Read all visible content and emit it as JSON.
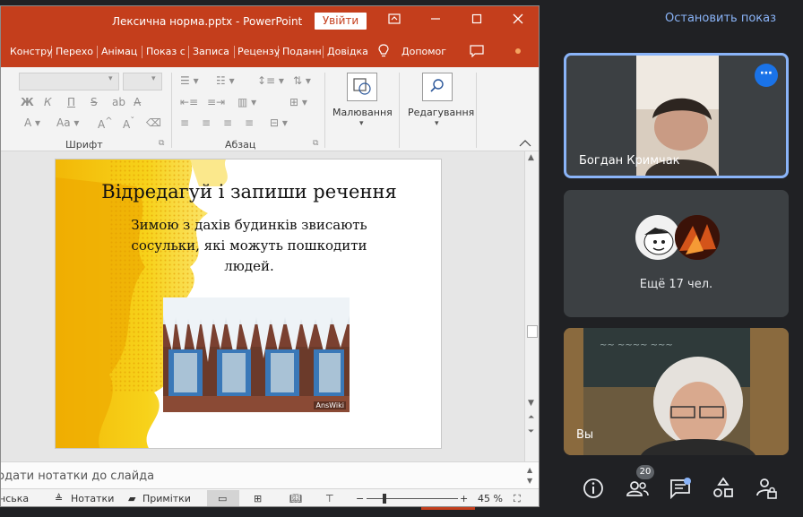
{
  "ppt": {
    "window_title": "Лексична норма.pptx  -  PowerPoint",
    "signin_label": "Увійти",
    "tabs": [
      "Констру",
      "Перехо",
      "Анімац",
      "Показ с",
      "Записа",
      "Рецензу",
      "Поданн",
      "Довідка"
    ],
    "tell_me": "Допомог",
    "ribbon": {
      "font_group_label": "Шрифт",
      "paragraph_group_label": "Абзац",
      "bold": "Ж",
      "italic": "К",
      "underline": "П",
      "strike": "S",
      "drawing_label": "Малювання",
      "editing_label": "Редагування"
    },
    "slide": {
      "title": "Відредагуй і запиши речення",
      "body": "Зимою з дахів будинків звисають сосульки, які можуть пошкодити людей.",
      "watermark": "AnsWiki"
    },
    "notes_placeholder": "Додати нотатки до слайда",
    "status": {
      "language": "нська",
      "notes_label": "Нотатки",
      "comments_label": "Примітки",
      "zoom_minus": "−",
      "zoom_plus": "+",
      "zoom_percent": "45 %"
    }
  },
  "meet": {
    "stop_presenting": "Остановить показ",
    "tiles": [
      {
        "name": "Богдан Кримчак"
      },
      {
        "name": "Ещё 17 чел."
      },
      {
        "name": "Вы"
      }
    ],
    "participants_count": "20"
  },
  "colors": {
    "ppt_accent": "#c43e1c",
    "meet_bg": "#202124",
    "meet_tile": "#3c4043",
    "meet_link": "#8ab4f8",
    "meet_highlight": "#1a73e8"
  },
  "icons": {
    "info": "info-icon",
    "people": "people-icon",
    "chat": "chat-icon",
    "activities": "activities-icon",
    "host_controls": "lock-person-icon"
  }
}
